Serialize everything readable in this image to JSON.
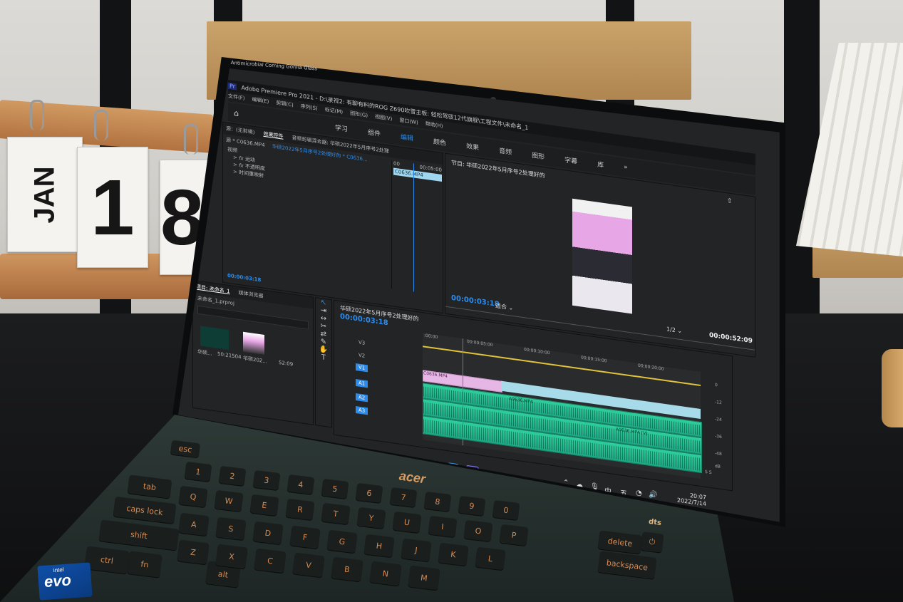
{
  "calendar": {
    "month": "JAN",
    "day_digit_1": "1",
    "day_digit_2": "8"
  },
  "laptop": {
    "bezel_text": "Antimicrobial Corning Gorilla Glass",
    "brand": "acer",
    "sticker_line1": "intel",
    "sticker_line2": "evo",
    "audio_badge": "dts",
    "keys": {
      "esc": "esc",
      "tab": "tab",
      "caps": "caps lock",
      "shift": "shift",
      "ctrl": "ctrl",
      "fn": "fn",
      "alt": "alt",
      "row_num": [
        "1",
        "2",
        "3",
        "4",
        "5",
        "6",
        "7",
        "8",
        "9",
        "0"
      ],
      "row_q": [
        "Q",
        "W",
        "E",
        "R",
        "T",
        "Y",
        "U",
        "I",
        "O",
        "P"
      ],
      "row_a": [
        "A",
        "S",
        "D",
        "F",
        "G",
        "H",
        "J",
        "K",
        "L"
      ],
      "row_z": [
        "Z",
        "X",
        "C",
        "V",
        "B",
        "N",
        "M"
      ],
      "backspace": "backspace",
      "delete": "delete"
    }
  },
  "app": {
    "title": "Adobe Premiere Pro 2021 - D:\\录视2: 有聊有料的ROG Z690吹雪主板: 轻松驾驭12代旗舰\\工程文件\\未命名_1",
    "menu": [
      "文件(F)",
      "编辑(E)",
      "剪辑(C)",
      "序列(S)",
      "标记(M)",
      "图形(G)",
      "视图(V)",
      "窗口(W)",
      "帮助(H)"
    ],
    "workspaces": [
      "学习",
      "组件",
      "编辑",
      "颜色",
      "效果",
      "音频",
      "图形",
      "字幕",
      "库"
    ],
    "active_workspace": "编辑",
    "source_tab": "源：(无剪辑)",
    "effect_controls_tab": "效果控件",
    "audio_mixer_tab": "音频剪辑混合器: 华硕2022年5月序号2处理",
    "clip_selector": "源 * C0636.MP4",
    "sequence_selector": "华硕2022年5月序号2处理好的 * C0636...",
    "effects": {
      "header": "视频",
      "items": [
        "运动",
        "不透明度",
        "时间重映射"
      ]
    },
    "mini_timeline": {
      "start": "00",
      "end": "00:05:00",
      "clip": "C0636.MP4"
    },
    "effect_timecode": "00:00:03:18",
    "program": {
      "title": "节目: 华硕2022年5月序号2处理好的",
      "timecode": "00:00:03:18",
      "fit": "适合",
      "resolution": "1/2",
      "duration": "00:00:52:09"
    },
    "project": {
      "tab": "项目: 未命名_1",
      "media_tab": "媒体浏览器",
      "file": "未命名_1.prproj",
      "items": [
        {
          "name": "华硕...",
          "duration": "50:21504"
        },
        {
          "name": "华硕202...",
          "duration": "52:09"
        }
      ]
    },
    "timeline": {
      "title": "华硕2022年5月序号2处理好的",
      "timecode": "00:00:03:18",
      "ruler": [
        ":00:00",
        "00:00:05:00",
        "00:00:10:00",
        "00:00:15:00",
        "00:00:20:00"
      ],
      "tracks": [
        "V3",
        "V2",
        "V1",
        "A1",
        "A2",
        "A3"
      ],
      "video_clips": [
        "C0636.MP4"
      ],
      "audio_clips": [
        "A0636.MP4",
        "A0636.MP4 [V]"
      ],
      "meter_scale": [
        "0",
        "-12",
        "-24",
        "-36",
        "-48",
        "dB"
      ],
      "solo": "S S"
    },
    "taskbar": {
      "ime_1": "中",
      "ime_2": "五",
      "time": "20:07",
      "date": "2022/7/14"
    }
  },
  "colors": {
    "accent_blue": "#2d8ceb",
    "video_clip": "#e6b6e5",
    "audio_clip": "#2fcf9e",
    "key_legend": "#d78b52"
  }
}
